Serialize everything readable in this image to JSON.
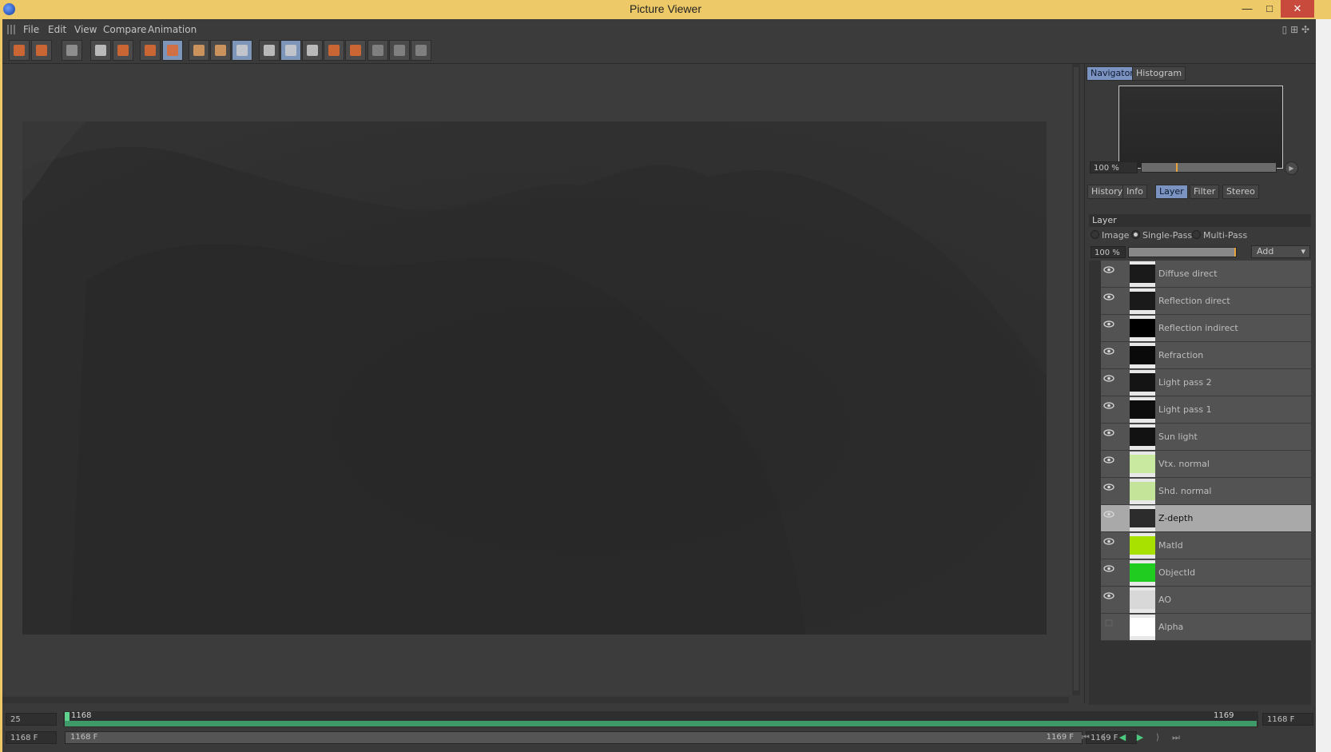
{
  "window": {
    "title": "Picture Viewer",
    "min_glyph": "—",
    "max_glyph": "□",
    "close_glyph": "✕"
  },
  "menu": [
    "File",
    "Edit",
    "View",
    "Compare",
    "Animation"
  ],
  "toolbar": {
    "buttons": [
      {
        "name": "open-icon",
        "on": false
      },
      {
        "name": "save-icon",
        "on": false
      },
      {
        "name": "grid-icon",
        "on": false
      },
      {
        "name": "region-icon",
        "on": false
      },
      {
        "name": "export-icon",
        "on": false
      },
      {
        "name": "copy-icon",
        "on": false
      },
      {
        "name": "paste-icon",
        "on": true
      },
      {
        "name": "frame-a-icon",
        "on": false
      },
      {
        "name": "frame-b-icon",
        "on": false
      },
      {
        "name": "compare-icon",
        "on": true
      },
      {
        "name": "ab-toggle-icon",
        "on": false
      },
      {
        "name": "ab-split-icon",
        "on": true
      },
      {
        "name": "ab-swap-icon",
        "on": false
      },
      {
        "name": "set-a-icon",
        "on": false
      },
      {
        "name": "set-b-icon",
        "on": false
      },
      {
        "name": "layout-1-icon",
        "on": false
      },
      {
        "name": "layout-2-icon",
        "on": false
      },
      {
        "name": "layout-3-icon",
        "on": false
      }
    ]
  },
  "panel": {
    "top_tabs": [
      {
        "label": "Navigator",
        "active": true
      },
      {
        "label": "Histogram",
        "active": false
      }
    ],
    "nav_zoom": "100 %",
    "zoom_level": 0.26,
    "sub_tabs": [
      {
        "label": "History",
        "active": false
      },
      {
        "label": "Info",
        "active": false
      },
      {
        "label": "Layer",
        "active": true
      },
      {
        "label": "Filter",
        "active": false
      },
      {
        "label": "Stereo",
        "active": false
      }
    ],
    "layer_header": "Layer",
    "modes": [
      {
        "label": "Image",
        "selected": false
      },
      {
        "label": "Single-Pass",
        "selected": true
      },
      {
        "label": "Multi-Pass",
        "selected": false
      }
    ],
    "opacity": "100 %",
    "opacity_level": 1.0,
    "add_label": "Add",
    "layers": [
      {
        "name": "Diffuse direct",
        "thumb": "#1a1a1a",
        "visible": true,
        "selected": false
      },
      {
        "name": "Reflection direct",
        "thumb": "#1a1a1a",
        "visible": true,
        "selected": false
      },
      {
        "name": "Reflection indirect",
        "thumb": "#000000",
        "visible": true,
        "selected": false
      },
      {
        "name": "Refraction",
        "thumb": "#0a0a0a",
        "visible": true,
        "selected": false
      },
      {
        "name": "Light pass 2",
        "thumb": "#141414",
        "visible": true,
        "selected": false
      },
      {
        "name": "Light pass 1",
        "thumb": "#0d0d0d",
        "visible": true,
        "selected": false
      },
      {
        "name": "Sun light",
        "thumb": "#121212",
        "visible": true,
        "selected": false
      },
      {
        "name": "Vtx. normal",
        "thumb": "#c9e8a0",
        "visible": true,
        "selected": false
      },
      {
        "name": "Shd. normal",
        "thumb": "#c4e49a",
        "visible": true,
        "selected": false
      },
      {
        "name": "Z-depth",
        "thumb": "#2c2c2c",
        "visible": true,
        "selected": true
      },
      {
        "name": "MatId",
        "thumb": "#a8e000",
        "visible": true,
        "selected": false
      },
      {
        "name": "ObjectId",
        "thumb": "#1fcc1f",
        "visible": true,
        "selected": false
      },
      {
        "name": "AO",
        "thumb": "#d8d8d8",
        "visible": true,
        "selected": false
      },
      {
        "name": "Alpha",
        "thumb": "#ffffff",
        "visible": false,
        "selected": false
      }
    ]
  },
  "timeline": {
    "fps": "25",
    "start_frame_label": "1168",
    "end_frame_label": "1169",
    "right_frame": "1168 F",
    "current_frame": "1168 F",
    "range_start": "1168 F",
    "range_end": "1169 F",
    "range_end_box": "1169 F",
    "playback": [
      {
        "name": "go-start-icon",
        "glyph": "⏮"
      },
      {
        "name": "prev-key-icon",
        "glyph": "⟨"
      },
      {
        "name": "play-back-icon",
        "glyph": "◀"
      },
      {
        "name": "play-icon",
        "glyph": "▶"
      },
      {
        "name": "next-key-icon",
        "glyph": "⟩"
      },
      {
        "name": "go-end-icon",
        "glyph": "⏭"
      }
    ]
  }
}
